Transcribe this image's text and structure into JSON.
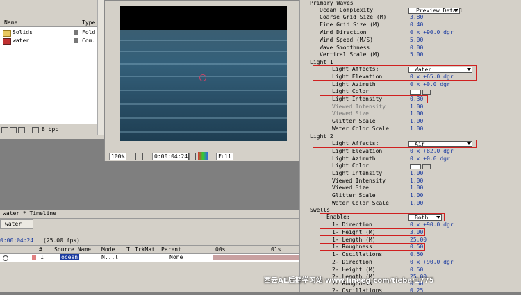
{
  "project": {
    "col_name": "Name",
    "col_type": "Type",
    "items": [
      {
        "name": "Solids",
        "type": "Fold"
      },
      {
        "name": "water",
        "type": "Com."
      }
    ],
    "bpc": "8 bpc"
  },
  "composition": {
    "zoom": "100%",
    "timecode": "0:00:04:24",
    "resolution": "Full"
  },
  "timeline": {
    "title": "water * Timeline",
    "tab": "water",
    "time": "0:00:04:24",
    "fps": "(25.00 fps)",
    "headers": [
      "#",
      "Source Name",
      "Mode",
      "T",
      "TrkMat",
      "Parent"
    ],
    "layer": {
      "num": "1",
      "name": "ocean",
      "mode": "N...l",
      "parent": "None"
    },
    "ruler": [
      "00s",
      "01s"
    ]
  },
  "effects": {
    "primary_waves_title": "Primary Waves",
    "ocean_complexity": {
      "label": "Ocean Complexity",
      "value": "Preview Detail"
    },
    "params_top": [
      {
        "label": "Coarse Grid Size (M)",
        "value": "3.80"
      },
      {
        "label": "Fine Grid Size (M)",
        "value": "0.40"
      },
      {
        "label": "Wind Direction",
        "value": "0 x +90.0 dgr"
      },
      {
        "label": "Wind Speed (M/S)",
        "value": "5.00"
      },
      {
        "label": "Wave Smoothness",
        "value": "0.00"
      },
      {
        "label": "Vertical Scale (M)",
        "value": "5.00"
      }
    ],
    "light1_title": "Light 1",
    "light1": [
      {
        "label": "Light Affects:",
        "value": "Water"
      },
      {
        "label": "Light Elevation",
        "value": "0 x +65.0 dgr"
      },
      {
        "label": "Light Azimuth",
        "value": "0 x +0.0 dgr"
      },
      {
        "label": "Light Color",
        "value": ""
      },
      {
        "label": "Light Intensity",
        "value": "0.30"
      },
      {
        "label": "Viewed Intensity",
        "value": "1.00"
      },
      {
        "label": "Viewed Size",
        "value": "1.00"
      },
      {
        "label": "Glitter Scale",
        "value": "1.00"
      },
      {
        "label": "Water Color Scale",
        "value": "1.00"
      }
    ],
    "light2_title": "Light 2",
    "light2": [
      {
        "label": "Light Affects:",
        "value": "Air"
      },
      {
        "label": "Light Elevation",
        "value": "0 x +82.0 dgr"
      },
      {
        "label": "Light Azimuth",
        "value": "0 x +0.0 dgr"
      },
      {
        "label": "Light Color",
        "value": ""
      },
      {
        "label": "Light Intensity",
        "value": "1.00"
      },
      {
        "label": "Viewed Intensity",
        "value": "1.00"
      },
      {
        "label": "Viewed Size",
        "value": "1.00"
      },
      {
        "label": "Glitter Scale",
        "value": "1.00"
      },
      {
        "label": "Water Color Scale",
        "value": "1.00"
      }
    ],
    "swells_title": "Swells",
    "swells": [
      {
        "label": "Enable:",
        "value": "Both"
      },
      {
        "label": "1- Direction",
        "value": "0 x +90.0 dgr"
      },
      {
        "label": "1- Height (M)",
        "value": "3.00"
      },
      {
        "label": "1- Length (M)",
        "value": "25.00"
      },
      {
        "label": "1- Roughness",
        "value": "0.50"
      },
      {
        "label": "1- Oscillations",
        "value": "0.50"
      },
      {
        "label": "2- Direction",
        "value": "0 x +90.0 dgr"
      },
      {
        "label": "2- Height (M)",
        "value": "0.50"
      },
      {
        "label": "2- Length (M)",
        "value": "25.00"
      },
      {
        "label": "2- Roughness",
        "value": "0.50"
      },
      {
        "label": "2- Oscillations",
        "value": "0.25"
      }
    ]
  },
  "watermark": "西云AE后期学习站 www.lineeg.com/tieba/1775"
}
